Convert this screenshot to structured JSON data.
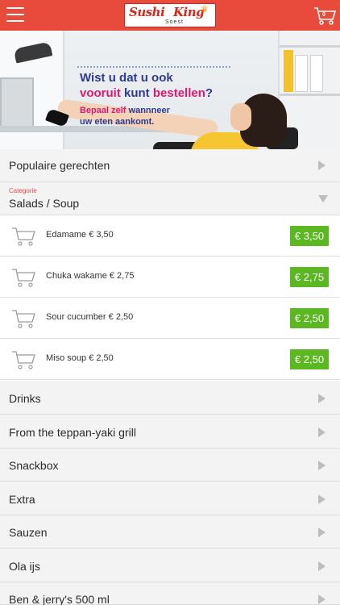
{
  "header": {
    "brand_word1": "Sushi",
    "brand_word2": "King",
    "brand_sub": "Soest",
    "cart_count": "0",
    "accent_color": "#e84a3c"
  },
  "banner": {
    "line1": "Wist u dat u ook",
    "line2_a": "vooruit",
    "line2_b": "kunt",
    "line2_c": "bestellen",
    "line2_d": "?",
    "line3_a": "Bepaal zelf",
    "line3_b": "wannneer",
    "line4": "uw eten aankomt."
  },
  "sections": {
    "popular": "Populaire gerechten",
    "category_label": "Categorie",
    "category_name": "Salads / Soup",
    "items": [
      {
        "name": "Edamame € 3,50",
        "price": "€ 3,50"
      },
      {
        "name": "Chuka wakame € 2,75",
        "price": "€ 2,75"
      },
      {
        "name": "Sour cucumber € 2,50",
        "price": "€ 2,50"
      },
      {
        "name": "Miso soup € 2,50",
        "price": "€ 2,50"
      }
    ],
    "categories": [
      "Drinks",
      "From the teppan-yaki grill",
      "Snackbox",
      "Extra",
      "Sauzen",
      "Ola ijs",
      "Ben & jerry's 500 ml"
    ]
  },
  "icons": {
    "menu": "hamburger-icon",
    "cart": "shopping-cart-icon",
    "expand": "chevron-right-icon",
    "collapse": "chevron-down-icon"
  },
  "colors": {
    "price_button": "#5cb822",
    "category_label": "#e84a3c"
  }
}
